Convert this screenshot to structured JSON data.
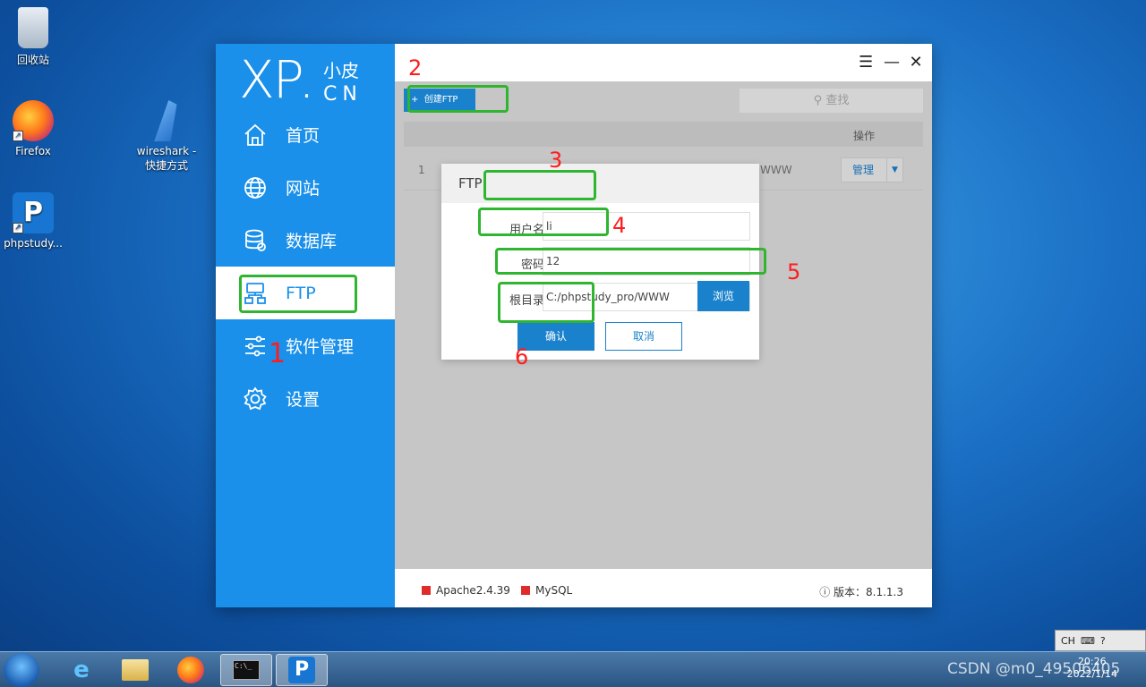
{
  "desktop": {
    "icons": [
      {
        "label": "回收站"
      },
      {
        "label": "Firefox"
      },
      {
        "label": "wireshark - 快捷方式"
      },
      {
        "label": "phpstudy..."
      }
    ]
  },
  "app": {
    "logo_main": "XP",
    "logo_dot": ".",
    "logo_sub1": "小皮",
    "logo_sub2": "CN",
    "nav": [
      {
        "label": "首页",
        "icon": "home-icon"
      },
      {
        "label": "网站",
        "icon": "globe-icon"
      },
      {
        "label": "数据库",
        "icon": "database-icon"
      },
      {
        "label": "FTP",
        "icon": "ftp-icon",
        "active": true
      },
      {
        "label": "软件管理",
        "icon": "sliders-icon"
      },
      {
        "label": "设置",
        "icon": "gear-icon"
      }
    ],
    "window_buttons": {
      "menu": "☰",
      "minimize": "—",
      "close": "✕"
    },
    "toolbar": {
      "create_label": "创建FTP",
      "search_placeholder": "查找"
    },
    "table": {
      "op_header": "操作",
      "rows": [
        {
          "index": "1",
          "dir": "WWW",
          "manage_label": "管理"
        }
      ]
    },
    "dialog": {
      "title": "FTP",
      "username_label": "用户名",
      "username_value": "li",
      "password_label": "密码",
      "password_value": "12",
      "root_label": "根目录",
      "root_value": "C:/phpstudy_pro/WWW",
      "browse_label": "浏览",
      "confirm_label": "确认",
      "cancel_label": "取消"
    },
    "status": {
      "services": [
        {
          "name": "Apache2.4.39"
        },
        {
          "name": "MySQL"
        }
      ],
      "version": "版本：8.1.1.3"
    }
  },
  "annotations": [
    "1",
    "2",
    "3",
    "4",
    "5",
    "6"
  ],
  "taskbar": {
    "time": "20:26",
    "date": "2022/1/14",
    "lang": "CH",
    "watermark": "CSDN @m0_49506405"
  },
  "colors": {
    "accent": "#1a90ea",
    "highlight": "#2fb52f",
    "annotation": "#ff1c1c"
  }
}
